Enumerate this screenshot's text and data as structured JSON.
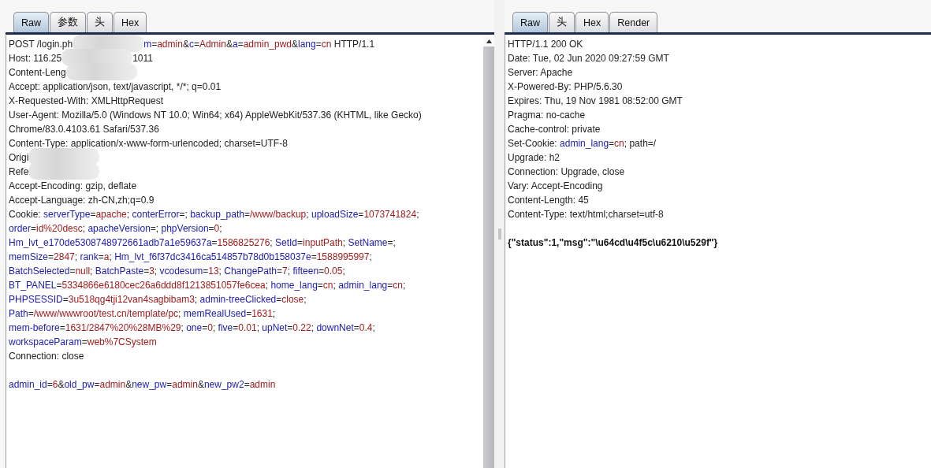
{
  "request": {
    "tabs": [
      {
        "label": "Raw",
        "selected": true
      },
      {
        "label": "参数",
        "selected": false
      },
      {
        "label": "头",
        "selected": false
      },
      {
        "label": "Hex",
        "selected": false
      }
    ],
    "lines": [
      [
        {
          "kind": "plain",
          "text": "POST /login.ph"
        },
        {
          "kind": "redacted"
        },
        {
          "kind": "name",
          "text": "m"
        },
        {
          "kind": "plain",
          "text": "="
        },
        {
          "kind": "value",
          "text": "admin"
        },
        {
          "kind": "plain",
          "text": "&"
        },
        {
          "kind": "name",
          "text": "c"
        },
        {
          "kind": "plain",
          "text": "="
        },
        {
          "kind": "value",
          "text": "Admin"
        },
        {
          "kind": "plain",
          "text": "&"
        },
        {
          "kind": "name",
          "text": "a"
        },
        {
          "kind": "plain",
          "text": "="
        },
        {
          "kind": "value",
          "text": "admin_pwd"
        },
        {
          "kind": "plain",
          "text": "&"
        },
        {
          "kind": "name",
          "text": "lang"
        },
        {
          "kind": "plain",
          "text": "="
        },
        {
          "kind": "value",
          "text": "cn"
        },
        {
          "kind": "plain",
          "text": " HTTP/1.1"
        }
      ],
      [
        {
          "kind": "plain",
          "text": "Host: 116.25"
        },
        {
          "kind": "redacted"
        },
        {
          "kind": "plain",
          "text": "1011"
        }
      ],
      [
        {
          "kind": "plain",
          "text": "Content-Leng"
        },
        {
          "kind": "redacted"
        }
      ],
      [
        {
          "kind": "plain",
          "text": "Accept: application/json, text/javascript, */*; q=0.01"
        }
      ],
      [
        {
          "kind": "plain",
          "text": "X-Requested-With: XMLHttpRequest"
        }
      ],
      [
        {
          "kind": "plain",
          "text": "User-Agent: Mozilla/5.0 (Windows NT 10.0; Win64; x64) AppleWebKit/537.36 (KHTML, like Gecko)"
        }
      ],
      [
        {
          "kind": "plain",
          "text": "Chrome/83.0.4103.61 Safari/537.36"
        }
      ],
      [
        {
          "kind": "plain",
          "text": "Content-Type: application/x-www-form-urlencoded; charset=UTF-8"
        }
      ],
      [
        {
          "kind": "plain",
          "text": "Origi"
        },
        {
          "kind": "redacted"
        }
      ],
      [
        {
          "kind": "plain",
          "text": "Refe"
        },
        {
          "kind": "redacted"
        }
      ],
      [
        {
          "kind": "plain",
          "text": "Accept-Encoding: gzip, deflate"
        }
      ],
      [
        {
          "kind": "plain",
          "text": "Accept-Language: zh-CN,zh;q=0.9"
        }
      ],
      [
        {
          "kind": "plain",
          "text": "Cookie: "
        },
        {
          "kind": "name",
          "text": "serverType"
        },
        {
          "kind": "plain",
          "text": "="
        },
        {
          "kind": "value",
          "text": "apache"
        },
        {
          "kind": "plain",
          "text": "; "
        },
        {
          "kind": "name",
          "text": "conterError"
        },
        {
          "kind": "plain",
          "text": "=; "
        },
        {
          "kind": "name",
          "text": "backup_path"
        },
        {
          "kind": "plain",
          "text": "="
        },
        {
          "kind": "value",
          "text": "/www/backup"
        },
        {
          "kind": "plain",
          "text": "; "
        },
        {
          "kind": "name",
          "text": "uploadSize"
        },
        {
          "kind": "plain",
          "text": "="
        },
        {
          "kind": "value",
          "text": "1073741824"
        },
        {
          "kind": "plain",
          "text": ";"
        }
      ],
      [
        {
          "kind": "name",
          "text": "order"
        },
        {
          "kind": "plain",
          "text": "="
        },
        {
          "kind": "value",
          "text": "id%20desc"
        },
        {
          "kind": "plain",
          "text": "; "
        },
        {
          "kind": "name",
          "text": "apacheVersion"
        },
        {
          "kind": "plain",
          "text": "=; "
        },
        {
          "kind": "name",
          "text": "phpVersion"
        },
        {
          "kind": "plain",
          "text": "="
        },
        {
          "kind": "value",
          "text": "0"
        },
        {
          "kind": "plain",
          "text": ";"
        }
      ],
      [
        {
          "kind": "name",
          "text": "Hm_lvt_e170de5308748972661adb7a1e59637a"
        },
        {
          "kind": "plain",
          "text": "="
        },
        {
          "kind": "value",
          "text": "1586825276"
        },
        {
          "kind": "plain",
          "text": "; "
        },
        {
          "kind": "name",
          "text": "SetId"
        },
        {
          "kind": "plain",
          "text": "="
        },
        {
          "kind": "value",
          "text": "inputPath"
        },
        {
          "kind": "plain",
          "text": "; "
        },
        {
          "kind": "name",
          "text": "SetName"
        },
        {
          "kind": "plain",
          "text": "=;"
        }
      ],
      [
        {
          "kind": "name",
          "text": "memSize"
        },
        {
          "kind": "plain",
          "text": "="
        },
        {
          "kind": "value",
          "text": "2847"
        },
        {
          "kind": "plain",
          "text": "; "
        },
        {
          "kind": "name",
          "text": "rank"
        },
        {
          "kind": "plain",
          "text": "="
        },
        {
          "kind": "value",
          "text": "a"
        },
        {
          "kind": "plain",
          "text": "; "
        },
        {
          "kind": "name",
          "text": "Hm_lvt_f6f37dc3416ca514857b78d0b158037e"
        },
        {
          "kind": "plain",
          "text": "="
        },
        {
          "kind": "value",
          "text": "1588995997"
        },
        {
          "kind": "plain",
          "text": ";"
        }
      ],
      [
        {
          "kind": "name",
          "text": "BatchSelected"
        },
        {
          "kind": "plain",
          "text": "="
        },
        {
          "kind": "value",
          "text": "null"
        },
        {
          "kind": "plain",
          "text": "; "
        },
        {
          "kind": "name",
          "text": "BatchPaste"
        },
        {
          "kind": "plain",
          "text": "="
        },
        {
          "kind": "value",
          "text": "3"
        },
        {
          "kind": "plain",
          "text": "; "
        },
        {
          "kind": "name",
          "text": "vcodesum"
        },
        {
          "kind": "plain",
          "text": "="
        },
        {
          "kind": "value",
          "text": "13"
        },
        {
          "kind": "plain",
          "text": "; "
        },
        {
          "kind": "name",
          "text": "ChangePath"
        },
        {
          "kind": "plain",
          "text": "="
        },
        {
          "kind": "value",
          "text": "7"
        },
        {
          "kind": "plain",
          "text": "; "
        },
        {
          "kind": "name",
          "text": "fifteen"
        },
        {
          "kind": "plain",
          "text": "="
        },
        {
          "kind": "value",
          "text": "0.05"
        },
        {
          "kind": "plain",
          "text": ";"
        }
      ],
      [
        {
          "kind": "name",
          "text": "BT_PANEL"
        },
        {
          "kind": "plain",
          "text": "="
        },
        {
          "kind": "value",
          "text": "5334866e6180cec26a6ddd8f1213851057fe6cea"
        },
        {
          "kind": "plain",
          "text": "; "
        },
        {
          "kind": "name",
          "text": "home_lang"
        },
        {
          "kind": "plain",
          "text": "="
        },
        {
          "kind": "value",
          "text": "cn"
        },
        {
          "kind": "plain",
          "text": "; "
        },
        {
          "kind": "name",
          "text": "admin_lang"
        },
        {
          "kind": "plain",
          "text": "="
        },
        {
          "kind": "value",
          "text": "cn"
        },
        {
          "kind": "plain",
          "text": ";"
        }
      ],
      [
        {
          "kind": "name",
          "text": "PHPSESSID"
        },
        {
          "kind": "plain",
          "text": "="
        },
        {
          "kind": "value",
          "text": "3u518qg4tji12van4sagbibam3"
        },
        {
          "kind": "plain",
          "text": "; "
        },
        {
          "kind": "name",
          "text": "admin-treeClicked"
        },
        {
          "kind": "plain",
          "text": "="
        },
        {
          "kind": "value",
          "text": "close"
        },
        {
          "kind": "plain",
          "text": ";"
        }
      ],
      [
        {
          "kind": "name",
          "text": "Path"
        },
        {
          "kind": "plain",
          "text": "="
        },
        {
          "kind": "value",
          "text": "/www/wwwroot/test.cn/template/pc"
        },
        {
          "kind": "plain",
          "text": "; "
        },
        {
          "kind": "name",
          "text": "memRealUsed"
        },
        {
          "kind": "plain",
          "text": "="
        },
        {
          "kind": "value",
          "text": "1631"
        },
        {
          "kind": "plain",
          "text": ";"
        }
      ],
      [
        {
          "kind": "name",
          "text": "mem-before"
        },
        {
          "kind": "plain",
          "text": "="
        },
        {
          "kind": "value",
          "text": "1631/2847%20%28MB%29"
        },
        {
          "kind": "plain",
          "text": "; "
        },
        {
          "kind": "name",
          "text": "one"
        },
        {
          "kind": "plain",
          "text": "="
        },
        {
          "kind": "value",
          "text": "0"
        },
        {
          "kind": "plain",
          "text": "; "
        },
        {
          "kind": "name",
          "text": "five"
        },
        {
          "kind": "plain",
          "text": "="
        },
        {
          "kind": "value",
          "text": "0.01"
        },
        {
          "kind": "plain",
          "text": "; "
        },
        {
          "kind": "name",
          "text": "upNet"
        },
        {
          "kind": "plain",
          "text": "="
        },
        {
          "kind": "value",
          "text": "0.22"
        },
        {
          "kind": "plain",
          "text": "; "
        },
        {
          "kind": "name",
          "text": "downNet"
        },
        {
          "kind": "plain",
          "text": "="
        },
        {
          "kind": "value",
          "text": "0.4"
        },
        {
          "kind": "plain",
          "text": ";"
        }
      ],
      [
        {
          "kind": "name",
          "text": "workspaceParam"
        },
        {
          "kind": "plain",
          "text": "="
        },
        {
          "kind": "value",
          "text": "web%7CSystem"
        }
      ],
      [
        {
          "kind": "plain",
          "text": "Connection: close"
        }
      ],
      [
        {
          "kind": "blank"
        }
      ],
      [
        {
          "kind": "name",
          "text": "admin_id"
        },
        {
          "kind": "plain",
          "text": "="
        },
        {
          "kind": "value",
          "text": "6"
        },
        {
          "kind": "plain",
          "text": "&"
        },
        {
          "kind": "name",
          "text": "old_pw"
        },
        {
          "kind": "plain",
          "text": "="
        },
        {
          "kind": "value",
          "text": "admin"
        },
        {
          "kind": "plain",
          "text": "&"
        },
        {
          "kind": "name",
          "text": "new_pw"
        },
        {
          "kind": "plain",
          "text": "="
        },
        {
          "kind": "value",
          "text": "admin"
        },
        {
          "kind": "plain",
          "text": "&"
        },
        {
          "kind": "name",
          "text": "new_pw2"
        },
        {
          "kind": "plain",
          "text": "="
        },
        {
          "kind": "value",
          "text": "admin"
        }
      ]
    ]
  },
  "response": {
    "tabs": [
      {
        "label": "Raw",
        "selected": true
      },
      {
        "label": "头",
        "selected": false
      },
      {
        "label": "Hex",
        "selected": false
      },
      {
        "label": "Render",
        "selected": false
      }
    ],
    "lines": [
      [
        {
          "kind": "plain",
          "text": "HTTP/1.1 200 OK"
        }
      ],
      [
        {
          "kind": "plain",
          "text": "Date: Tue, 02 Jun 2020 09:27:59 GMT"
        }
      ],
      [
        {
          "kind": "plain",
          "text": "Server: Apache"
        }
      ],
      [
        {
          "kind": "plain",
          "text": "X-Powered-By: PHP/5.6.30"
        }
      ],
      [
        {
          "kind": "plain",
          "text": "Expires: Thu, 19 Nov 1981 08:52:00 GMT"
        }
      ],
      [
        {
          "kind": "plain",
          "text": "Pragma: no-cache"
        }
      ],
      [
        {
          "kind": "plain",
          "text": "Cache-control: private"
        }
      ],
      [
        {
          "kind": "plain",
          "text": "Set-Cookie: "
        },
        {
          "kind": "name",
          "text": "admin_lang"
        },
        {
          "kind": "plain",
          "text": "="
        },
        {
          "kind": "value",
          "text": "cn"
        },
        {
          "kind": "plain",
          "text": "; path=/"
        }
      ],
      [
        {
          "kind": "plain",
          "text": "Upgrade: h2"
        }
      ],
      [
        {
          "kind": "plain",
          "text": "Connection: Upgrade, close"
        }
      ],
      [
        {
          "kind": "plain",
          "text": "Vary: Accept-Encoding"
        }
      ],
      [
        {
          "kind": "plain",
          "text": "Content-Length: 45"
        }
      ],
      [
        {
          "kind": "plain",
          "text": "Content-Type: text/html;charset=utf-8"
        }
      ],
      [
        {
          "kind": "blank"
        }
      ],
      [
        {
          "kind": "body",
          "text": "{\"status\":1,\"msg\":\"\\u64cd\\u4f5c\\u6210\\u529f\"}"
        }
      ]
    ]
  }
}
